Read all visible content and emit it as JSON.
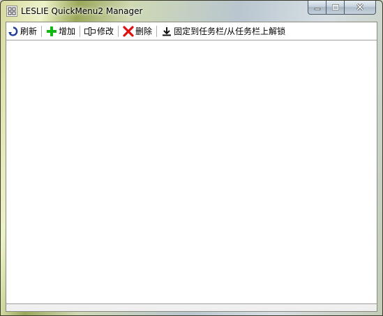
{
  "window": {
    "title": "LESLIE QuickMenu2 Manager"
  },
  "toolbar": {
    "refresh_label": "刷新",
    "add_label": "增加",
    "edit_label": "修改",
    "delete_label": "删除",
    "pin_label": "固定到任务栏/从任务栏上解锁"
  },
  "icons": {
    "refresh": "refresh-icon",
    "add": "plus-icon",
    "edit": "edit-icon",
    "delete": "x-icon",
    "pin": "download-arrow-icon"
  },
  "colors": {
    "refresh_icon": "#1f3d99",
    "add_icon": "#12b812",
    "delete_icon": "#e01010"
  }
}
